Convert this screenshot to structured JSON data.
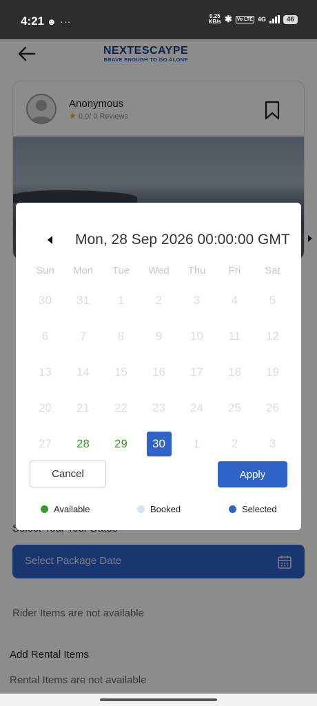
{
  "status_bar": {
    "time": "4:21",
    "left_icons": "☻ ···",
    "net_speed": "0.25",
    "net_unit": "KB/s",
    "volte": "Vo LTE",
    "network": "4G",
    "battery": "46"
  },
  "header": {
    "brand": "NEXTESCAYPE",
    "tagline": "BRAVE ENOUGH TO GO ALONE"
  },
  "card": {
    "user_name": "Anonymous",
    "rating_text": "0.0/ 0 Reviews"
  },
  "date_picker": {
    "header_date": "Mon, 28 Sep 2026 00:00:00 GMT",
    "weekdays": [
      "Sun",
      "Mon",
      "Tue",
      "Wed",
      "Thu",
      "Fri",
      "Sat"
    ],
    "weeks": [
      [
        {
          "day": "30",
          "state": "disabled"
        },
        {
          "day": "31",
          "state": "disabled"
        },
        {
          "day": "1",
          "state": "disabled"
        },
        {
          "day": "2",
          "state": "disabled"
        },
        {
          "day": "3",
          "state": "disabled"
        },
        {
          "day": "4",
          "state": "disabled"
        },
        {
          "day": "5",
          "state": "disabled"
        }
      ],
      [
        {
          "day": "6",
          "state": "disabled"
        },
        {
          "day": "7",
          "state": "disabled"
        },
        {
          "day": "8",
          "state": "disabled"
        },
        {
          "day": "9",
          "state": "disabled"
        },
        {
          "day": "10",
          "state": "disabled"
        },
        {
          "day": "11",
          "state": "disabled"
        },
        {
          "day": "12",
          "state": "disabled"
        }
      ],
      [
        {
          "day": "13",
          "state": "disabled"
        },
        {
          "day": "14",
          "state": "disabled"
        },
        {
          "day": "15",
          "state": "disabled"
        },
        {
          "day": "16",
          "state": "disabled"
        },
        {
          "day": "17",
          "state": "disabled"
        },
        {
          "day": "18",
          "state": "disabled"
        },
        {
          "day": "19",
          "state": "disabled"
        }
      ],
      [
        {
          "day": "20",
          "state": "disabled"
        },
        {
          "day": "21",
          "state": "disabled"
        },
        {
          "day": "22",
          "state": "disabled"
        },
        {
          "day": "23",
          "state": "disabled"
        },
        {
          "day": "24",
          "state": "disabled"
        },
        {
          "day": "25",
          "state": "disabled"
        },
        {
          "day": "26",
          "state": "disabled"
        }
      ],
      [
        {
          "day": "27",
          "state": "disabled"
        },
        {
          "day": "28",
          "state": "available"
        },
        {
          "day": "29",
          "state": "available"
        },
        {
          "day": "30",
          "state": "selected"
        },
        {
          "day": "1",
          "state": "disabled"
        },
        {
          "day": "2",
          "state": "disabled"
        },
        {
          "day": "3",
          "state": "disabled"
        }
      ]
    ],
    "cancel_label": "Cancel",
    "apply_label": "Apply",
    "legend": {
      "available": "Available",
      "booked": "Booked",
      "selected": "Selected"
    },
    "colors": {
      "available": "#3a9a2e",
      "booked": "#d6e4f5",
      "selected": "#2f63c8"
    }
  },
  "background": {
    "tour_dates_label": "Select Your Tour Dates",
    "package_date_placeholder": "Select Package Date",
    "rider_items_text": "Rider Items are not available",
    "rental_title": "Add Rental Items",
    "rental_text": "Rental Items are not available"
  }
}
